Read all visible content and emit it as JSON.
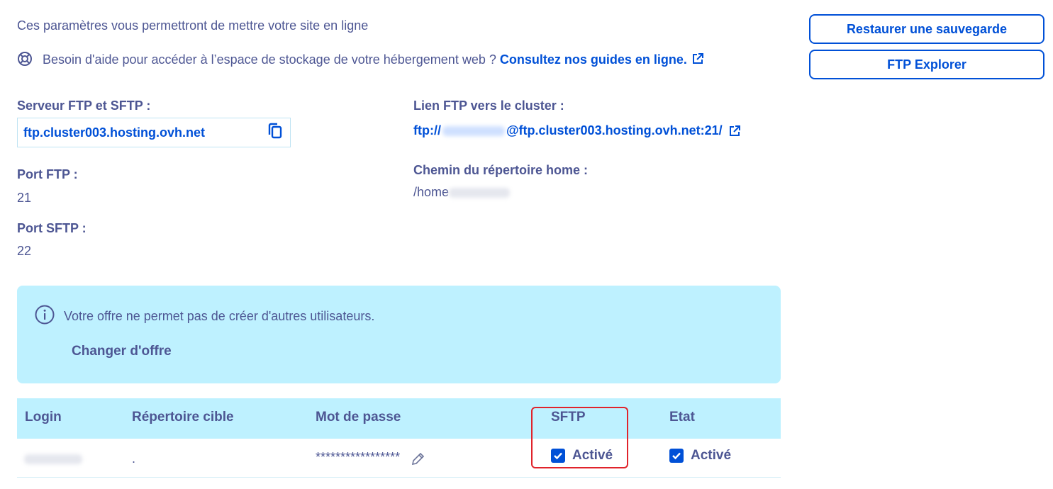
{
  "intro_text": "Ces paramètres vous permettront de mettre votre site en ligne",
  "help": {
    "text": "Besoin d'aide pour accéder à l’espace de stockage de votre hébergement web ?",
    "link": "Consultez nos guides en ligne."
  },
  "actions": {
    "restore": "Restaurer une sauvegarde",
    "ftp_explorer": "FTP Explorer"
  },
  "server": {
    "label": "Serveur FTP et SFTP :",
    "value": "ftp.cluster003.hosting.ovh.net"
  },
  "cluster_link": {
    "label": "Lien FTP vers le cluster :",
    "prefix": "ftp://",
    "suffix": "@ftp.cluster003.hosting.ovh.net:21/"
  },
  "home_dir": {
    "label": "Chemin du répertoire home :",
    "prefix": "/home"
  },
  "port_ftp": {
    "label": "Port FTP :",
    "value": "21"
  },
  "port_sftp": {
    "label": "Port SFTP :",
    "value": "22"
  },
  "notice": {
    "text": "Votre offre ne permet pas de créer d'autres utilisateurs.",
    "action": "Changer d'offre"
  },
  "table": {
    "headers": [
      "Login",
      "Répertoire cible",
      "Mot de passe",
      "SFTP",
      "Etat"
    ],
    "row": {
      "directory": ".",
      "password": "*****************",
      "sftp": "Activé",
      "state": "Activé"
    }
  },
  "colors": {
    "primary": "#0050d7",
    "text": "#4d5693",
    "info_bg": "#bef1ff",
    "highlight": "#e0232b"
  }
}
